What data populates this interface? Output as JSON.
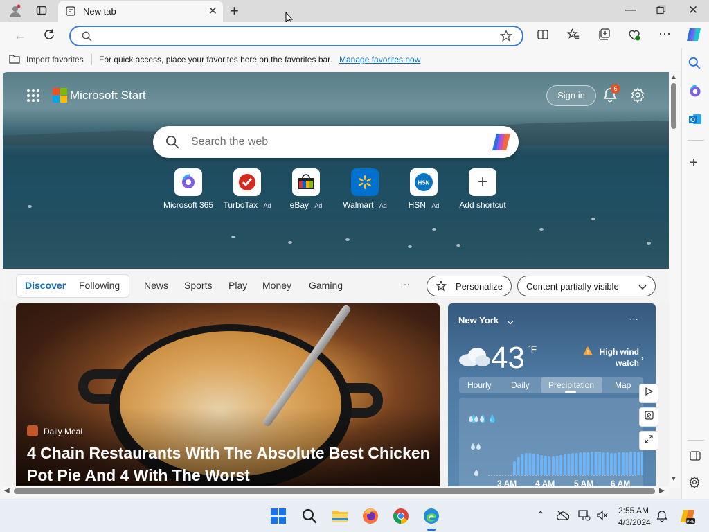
{
  "window": {
    "tab_title": "New tab",
    "new_tab_symbol": "+"
  },
  "toolbar": {
    "address_value": "",
    "address_placeholder": ""
  },
  "favorites_bar": {
    "import_label": "Import favorites",
    "message": "For quick access, place your favorites here on the favorites bar.",
    "manage_link": "Manage favorites now"
  },
  "header": {
    "brand": "Microsoft Start",
    "sign_in": "Sign in",
    "notification_count": "6"
  },
  "search": {
    "placeholder": "Search the web"
  },
  "quick_links": [
    {
      "label": "Microsoft 365",
      "ad": ""
    },
    {
      "label": "TurboTax",
      "ad": "· Ad"
    },
    {
      "label": "eBay",
      "ad": "· Ad"
    },
    {
      "label": "Walmart",
      "ad": "· Ad"
    },
    {
      "label": "HSN",
      "ad": "· Ad"
    },
    {
      "label": "Add shortcut",
      "ad": ""
    }
  ],
  "feed_nav": {
    "tabs": [
      "Discover",
      "Following"
    ],
    "items": [
      "News",
      "Sports",
      "Play",
      "Money",
      "Gaming"
    ],
    "more": "···",
    "personalize": "Personalize",
    "content_visibility": "Content partially visible"
  },
  "article": {
    "source": "Daily Meal",
    "headline": "4 Chain Restaurants With The Absolute Best Chicken Pot Pie And 4 With The Worst"
  },
  "weather": {
    "location": "New York",
    "temperature": "43",
    "unit": "°F",
    "alert": "High wind watch",
    "tabs": [
      "Hourly",
      "Daily",
      "Precipitation",
      "Map"
    ],
    "active_tab": "Precipitation",
    "time_labels": [
      "3 AM",
      "4 AM",
      "5 AM",
      "6 AM"
    ],
    "more": "···"
  },
  "taskbar": {
    "time": "2:55 AM",
    "date": "4/3/2024"
  },
  "colors": {
    "accent": "#0f6cbd",
    "address_border": "#3b78d8"
  }
}
